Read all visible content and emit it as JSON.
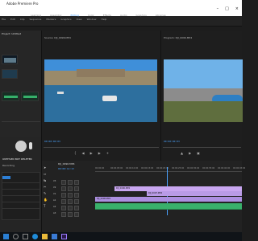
{
  "window": {
    "title": "Adobe Premiere Pro"
  },
  "menu": {
    "items": [
      "File",
      "Edit",
      "Clip",
      "Sequence",
      "Markers",
      "Graphics",
      "View",
      "Window",
      "Help"
    ]
  },
  "workspaces": {
    "items": [
      "Learning",
      "Assembly",
      "Editing",
      "Color",
      "Effects",
      "Audio",
      "Graphics",
      "Libraries"
    ],
    "active_index": 2
  },
  "source_panel": {
    "tab_label": "Project: Untitled"
  },
  "effects_panel": {
    "title": "UNTITLED BOT DELETER",
    "subtitle": "Recording"
  },
  "source_monitor": {
    "tab_label": "Source: DJI_0096.MP4",
    "timecode": "00:00:00:03"
  },
  "program_monitor": {
    "tab_label": "Program: DJI_0096.MP4",
    "timecode": "00:00:00:03"
  },
  "timeline": {
    "tab_label": "DJI_0096.MP4",
    "timecode": "00:00:14:13",
    "ruler_ticks": [
      "00:00:00",
      "00:00:05:00",
      "00:00:10:00",
      "00:00:15:00",
      "00:00:20:00",
      "00:00:25:00",
      "00:00:30:00",
      "00:00:35:00",
      "00:00:40:00",
      "00:00:45:00"
    ],
    "tracks": [
      "V3",
      "V2",
      "V1",
      "A1",
      "A2",
      "A3"
    ],
    "clips": [
      {
        "label": "DJI_0096.MP4",
        "color": "#c8a6f0"
      },
      {
        "label": "DJI_0097.MP4",
        "color": "#b99be6"
      },
      {
        "label": "DJI_0098.MP4",
        "color": "#ac8fe0"
      },
      {
        "label": "",
        "color": "#39b06b"
      }
    ]
  },
  "colors": {
    "accent": "#4aa3ff",
    "clip_purple": "#c8a6f0",
    "clip_green": "#39b06b",
    "panel_bg": "#262626"
  },
  "taskbar": {
    "icons": [
      "windows-start-icon",
      "search-icon",
      "task-view-icon",
      "edge-icon",
      "folder-icon",
      "store-icon",
      "premiere-icon"
    ]
  }
}
